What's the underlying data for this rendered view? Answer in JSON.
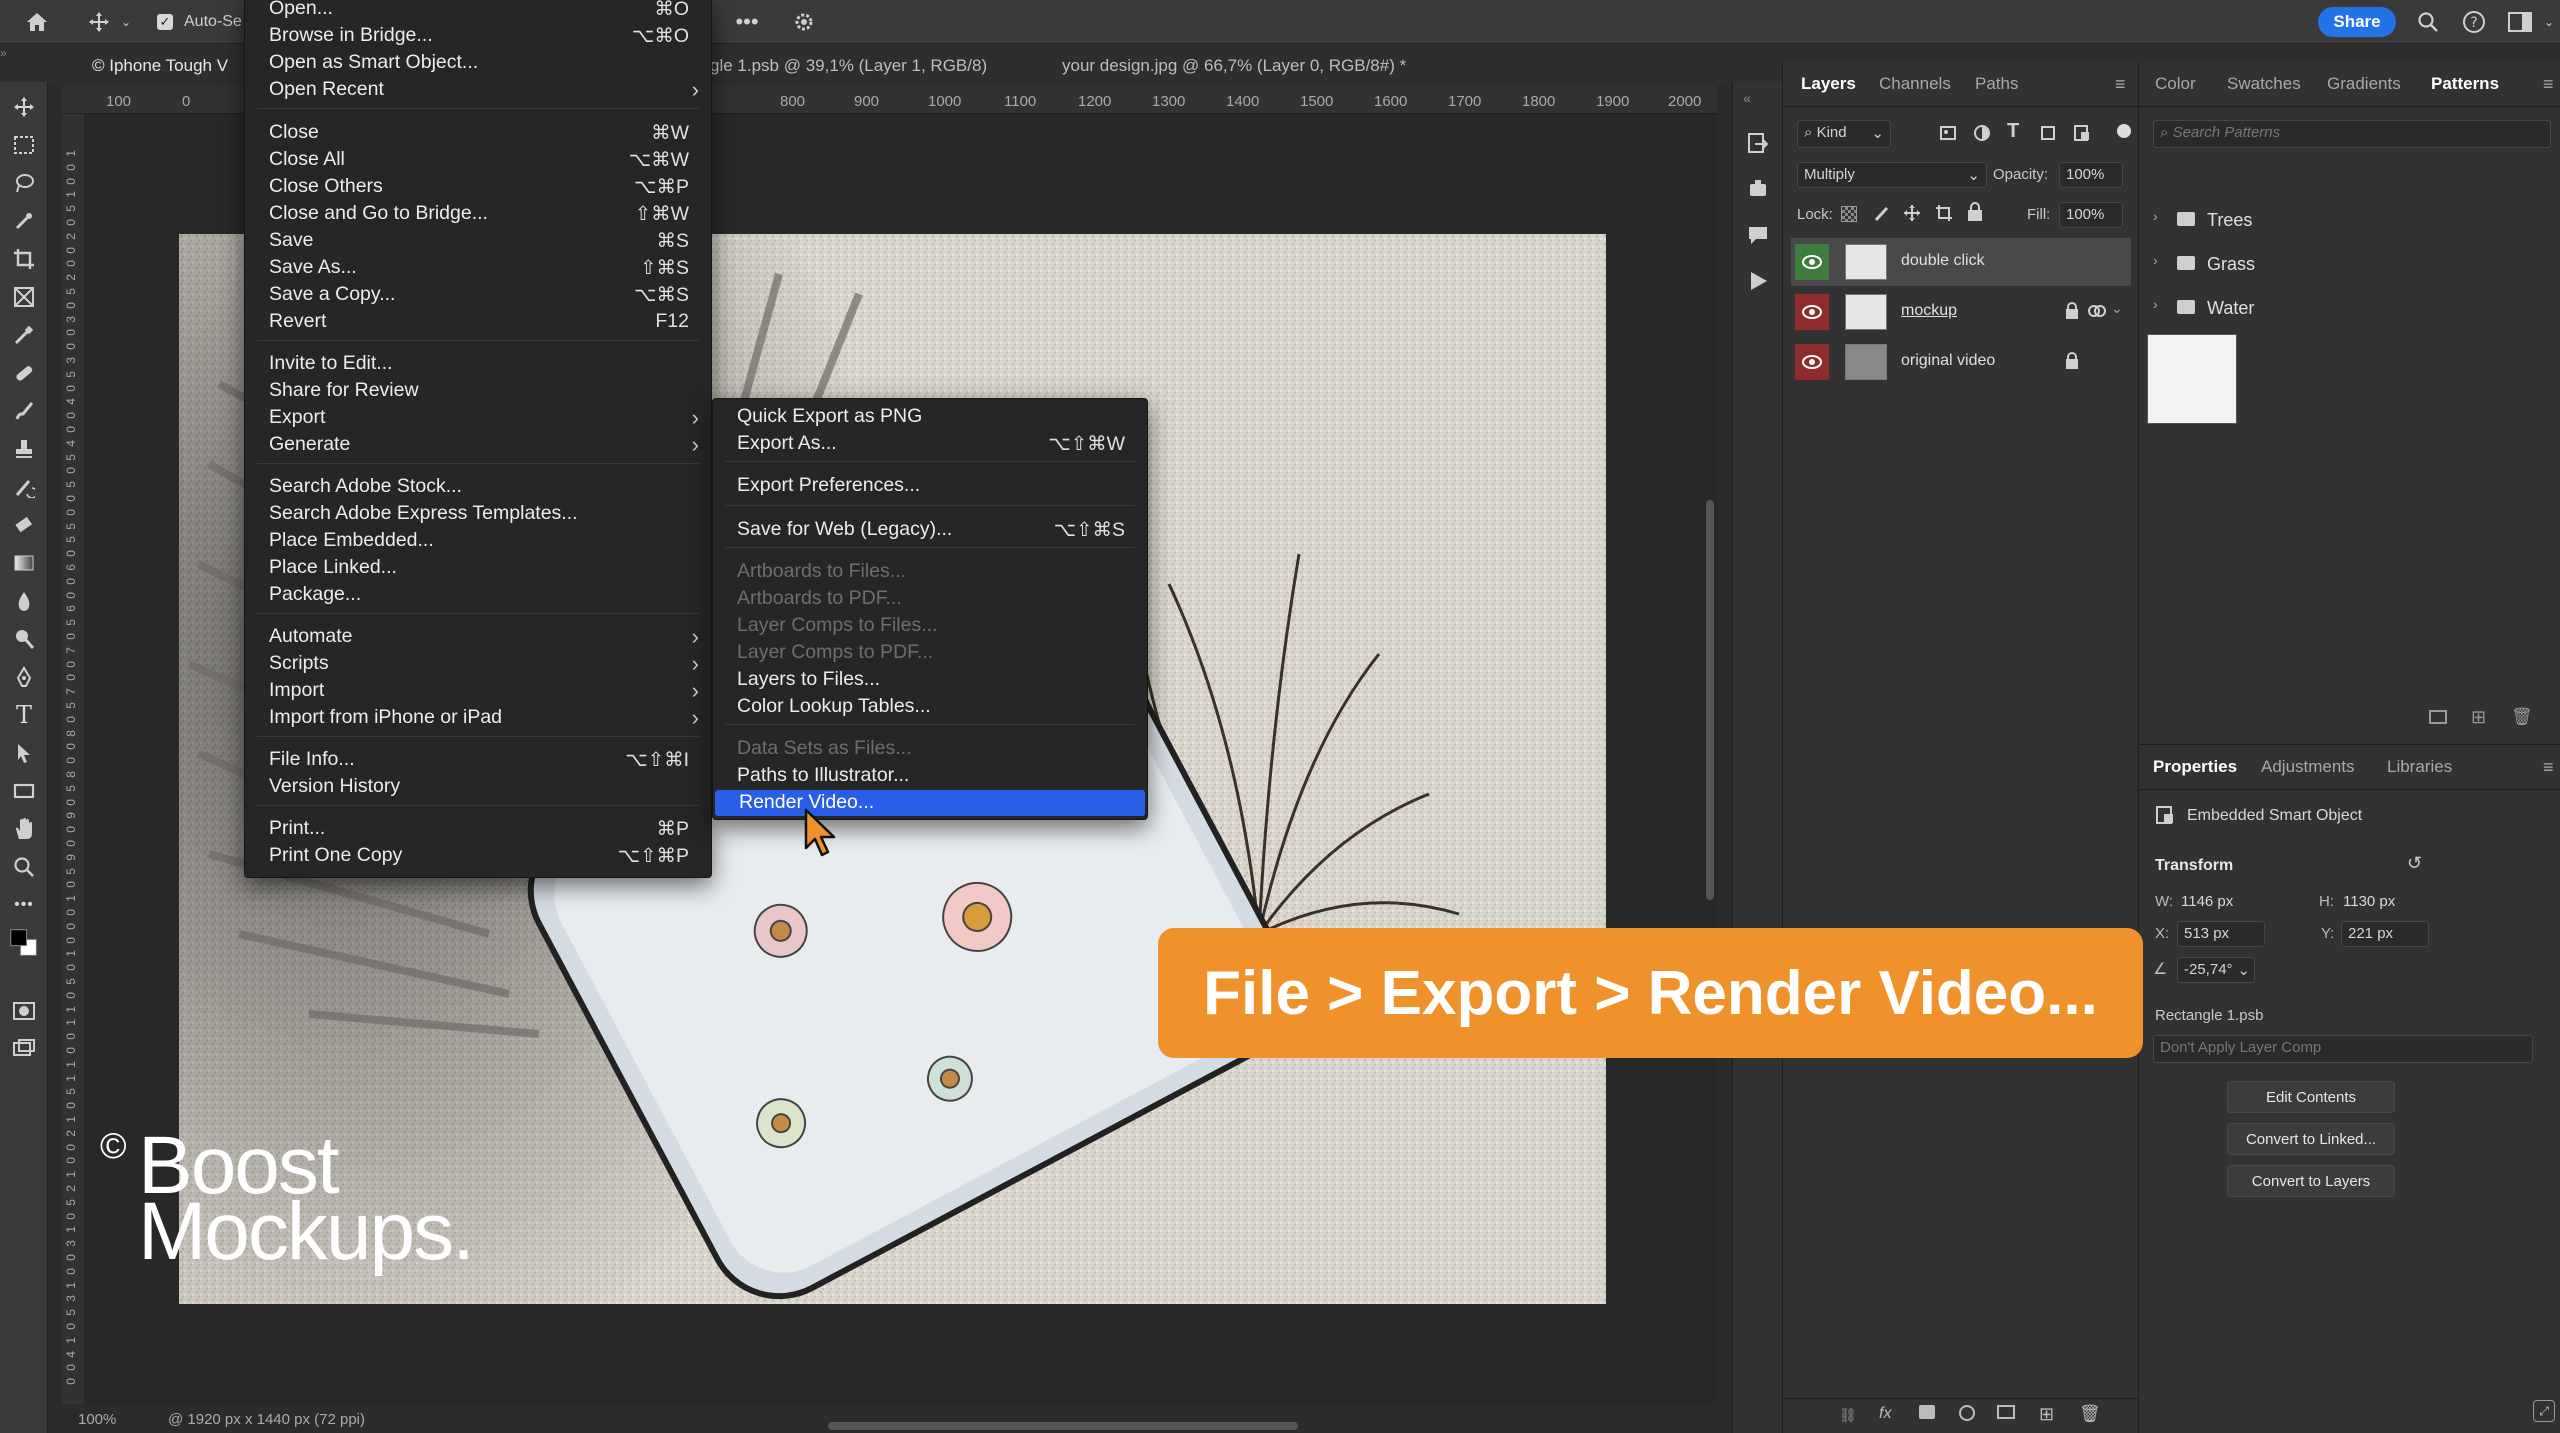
{
  "optionbar": {
    "auto_select_label": "Auto-Se",
    "share_label": "Share"
  },
  "tabs": [
    {
      "label": "© Iphone Tough V"
    },
    {
      "label": "gle 1.psb @ 39,1% (Layer 1, RGB/8)"
    },
    {
      "label": "your design.jpg @ 66,7% (Layer 0, RGB/8#) *"
    }
  ],
  "ruler_h": [
    "100",
    "0",
    "800",
    "900",
    "1000",
    "1100",
    "1200",
    "1300",
    "1400",
    "1500",
    "1600",
    "1700",
    "1800",
    "1900",
    "2000"
  ],
  "ruler_v": [
    "1",
    "0",
    "0",
    "1",
    "5",
    "0",
    "2",
    "0",
    "0",
    "2",
    "5",
    "0",
    "3",
    "0",
    "0",
    "3",
    "5",
    "0",
    "4",
    "0",
    "0",
    "4",
    "5",
    "0",
    "5",
    "0",
    "0",
    "5",
    "5",
    "0",
    "6",
    "0",
    "0",
    "6",
    "5",
    "0",
    "7",
    "0",
    "0",
    "7",
    "5",
    "0",
    "8",
    "0",
    "0",
    "8",
    "5",
    "0",
    "9",
    "0",
    "0",
    "9",
    "5",
    "0",
    "1",
    "0",
    "0",
    "0",
    "1",
    "0",
    "5",
    "0",
    "1",
    "1",
    "0",
    "0",
    "1",
    "1",
    "5",
    "0",
    "1",
    "2",
    "0",
    "0",
    "1",
    "2",
    "5",
    "0",
    "1",
    "3",
    "0",
    "0",
    "1",
    "3",
    "5",
    "0",
    "1",
    "4",
    "0",
    "0"
  ],
  "file_menu": {
    "items": [
      {
        "label": "Open...",
        "shortcut": "⌘O"
      },
      {
        "label": "Browse in Bridge...",
        "shortcut": "⌥⌘O"
      },
      {
        "label": "Open as Smart Object...",
        "shortcut": ""
      },
      {
        "label": "Open Recent",
        "shortcut": "",
        "submenu": true
      },
      {
        "label": "Close",
        "shortcut": "⌘W"
      },
      {
        "label": "Close All",
        "shortcut": "⌥⌘W"
      },
      {
        "label": "Close Others",
        "shortcut": "⌥⌘P"
      },
      {
        "label": "Close and Go to Bridge...",
        "shortcut": "⇧⌘W"
      },
      {
        "label": "Save",
        "shortcut": "⌘S"
      },
      {
        "label": "Save As...",
        "shortcut": "⇧⌘S"
      },
      {
        "label": "Save a Copy...",
        "shortcut": "⌥⌘S"
      },
      {
        "label": "Revert",
        "shortcut": "F12"
      },
      {
        "label": "Invite to Edit...",
        "shortcut": ""
      },
      {
        "label": "Share for Review",
        "shortcut": ""
      },
      {
        "label": "Export",
        "shortcut": "",
        "submenu": true
      },
      {
        "label": "Generate",
        "shortcut": "",
        "submenu": true
      },
      {
        "label": "Search Adobe Stock...",
        "shortcut": ""
      },
      {
        "label": "Search Adobe Express Templates...",
        "shortcut": ""
      },
      {
        "label": "Place Embedded...",
        "shortcut": ""
      },
      {
        "label": "Place Linked...",
        "shortcut": ""
      },
      {
        "label": "Package...",
        "shortcut": ""
      },
      {
        "label": "Automate",
        "shortcut": "",
        "submenu": true
      },
      {
        "label": "Scripts",
        "shortcut": "",
        "submenu": true
      },
      {
        "label": "Import",
        "shortcut": "",
        "submenu": true
      },
      {
        "label": "Import from iPhone or iPad",
        "shortcut": "",
        "submenu": true
      },
      {
        "label": "File Info...",
        "shortcut": "⌥⇧⌘I"
      },
      {
        "label": "Version History",
        "shortcut": ""
      },
      {
        "label": "Print...",
        "shortcut": "⌘P"
      },
      {
        "label": "Print One Copy",
        "shortcut": "⌥⇧⌘P"
      }
    ]
  },
  "export_menu": {
    "items": [
      {
        "label": "Quick Export as PNG",
        "shortcut": ""
      },
      {
        "label": "Export As...",
        "shortcut": "⌥⇧⌘W"
      },
      {
        "label": "Export Preferences...",
        "shortcut": ""
      },
      {
        "label": "Save for Web (Legacy)...",
        "shortcut": "⌥⇧⌘S"
      },
      {
        "label": "Artboards to Files...",
        "shortcut": "",
        "disabled": true
      },
      {
        "label": "Artboards to PDF...",
        "shortcut": "",
        "disabled": true
      },
      {
        "label": "Layer Comps to Files...",
        "shortcut": "",
        "disabled": true
      },
      {
        "label": "Layer Comps to PDF...",
        "shortcut": "",
        "disabled": true
      },
      {
        "label": "Layers to Files...",
        "shortcut": ""
      },
      {
        "label": "Color Lookup Tables...",
        "shortcut": ""
      },
      {
        "label": "Data Sets as Files...",
        "shortcut": "",
        "disabled": true
      },
      {
        "label": "Paths to Illustrator...",
        "shortcut": ""
      },
      {
        "label": "Render Video...",
        "shortcut": "",
        "highlighted": true
      }
    ]
  },
  "layers_panel": {
    "tabs": [
      "Layers",
      "Channels",
      "Paths"
    ],
    "kind_label": "Kind",
    "blend_mode": "Multiply",
    "opacity_label": "Opacity:",
    "opacity_value": "100%",
    "lock_label": "Lock:",
    "fill_label": "Fill:",
    "fill_value": "100%",
    "layers": [
      {
        "name": "double click",
        "locked": false
      },
      {
        "name": "mockup",
        "locked": true
      },
      {
        "name": "original video",
        "locked": true
      }
    ]
  },
  "patterns_panel": {
    "tabs": [
      "Color",
      "Swatches",
      "Gradients",
      "Patterns"
    ],
    "search_placeholder": "Search Patterns",
    "groups": [
      "Trees",
      "Grass",
      "Water"
    ]
  },
  "properties_panel": {
    "tabs": [
      "Properties",
      "Adjustments",
      "Libraries"
    ],
    "object_type": "Embedded Smart Object",
    "transform_label": "Transform",
    "w_label": "W:",
    "w_value": "1146 px",
    "h_label": "H:",
    "h_value": "1130 px",
    "x_label": "X:",
    "x_value": "513 px",
    "y_label": "Y:",
    "y_value": "221 px",
    "angle_value": "-25,74°",
    "file_name": "Rectangle 1.psb",
    "layer_comp": "Don't Apply Layer Comp",
    "buttons": [
      "Edit Contents",
      "Convert to Linked...",
      "Convert to Layers"
    ]
  },
  "statusbar": {
    "zoom": "100%",
    "doc_info": "@ 1920 px x 1440 px (72 ppi)"
  },
  "overlay": {
    "banner_text": "File > Export > Render Video...",
    "watermark_line1": "Boost",
    "watermark_line2": "Mockups.",
    "watermark_symbol": "©"
  },
  "colors": {
    "accent": "#2b5ee8",
    "banner": "#f0922c",
    "share": "#2473e6"
  }
}
